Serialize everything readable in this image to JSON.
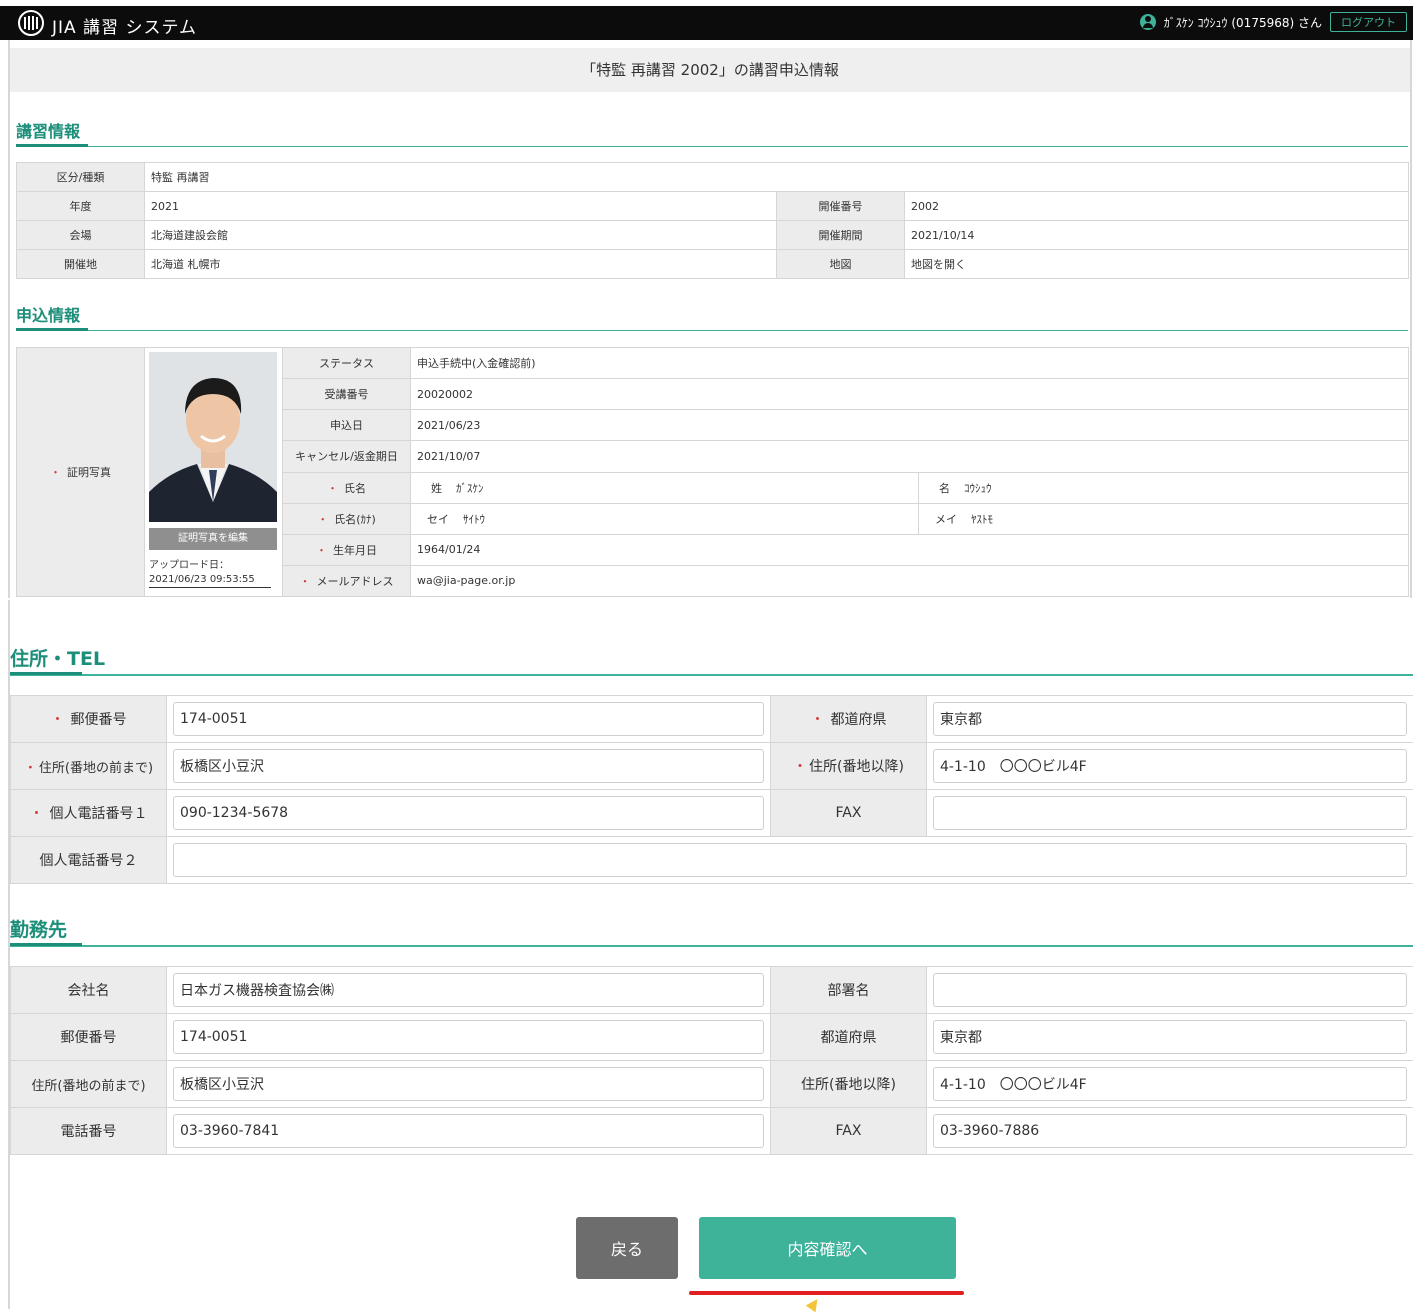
{
  "header": {
    "app_title": "JIA 講習 システム",
    "user_text": "ｶﾞｽｹﾝ ｺｳｼｭｳ (0175968) さん",
    "logout_label": "ログアウト",
    "accent_color": "#3fb29a"
  },
  "page_title": "「特監 再講習 2002」の講習申込情報",
  "course_info": {
    "section_title": "講習情報",
    "rows": {
      "category_label": "区分/種類",
      "category_value": "特監 再講習",
      "year_label": "年度",
      "year_value": "2021",
      "session_no_label": "開催番号",
      "session_no_value": "2002",
      "venue_label": "会場",
      "venue_value": "北海道建設会館",
      "period_label": "開催期間",
      "period_value": "2021/10/14",
      "location_label": "開催地",
      "location_value": "北海道 札幌市",
      "map_label": "地図",
      "map_value": "地図を開く"
    }
  },
  "application_info": {
    "section_title": "申込情報",
    "photo_label": "証明写真",
    "edit_photo_label": "証明写真を編集",
    "upload_label": "アップロード日：",
    "upload_value": "2021/06/23 09:53:55",
    "status_label": "ステータス",
    "status_value": "申込手続中(入金確認前)",
    "student_no_label": "受講番号",
    "student_no_value": "20020002",
    "apply_date_label": "申込日",
    "apply_date_value": "2021/06/23",
    "cancel_date_label": "キャンセル/返金期日",
    "cancel_date_value": "2021/10/07",
    "name_label": "氏名",
    "last_name_label": "姓",
    "last_name_value": "ｶﾞｽｹﾝ",
    "first_name_label": "名",
    "first_name_value": "ｺｳｼｭｳ",
    "kana_label": "氏名(ｶﾅ)",
    "kana_last_label": "セイ",
    "kana_last_value": "ｻｲﾄｳ",
    "kana_first_label": "メイ",
    "kana_first_value": "ﾔｽﾄﾓ",
    "birth_label": "生年月日",
    "birth_value": "1964/01/24",
    "email_label": "メールアドレス",
    "email_value": "wa@jia-page.or.jp"
  },
  "address": {
    "section_title": "住所・TEL",
    "postal_label": "郵便番号",
    "postal_value": "174-0051",
    "pref_label": "都道府県",
    "pref_value": "東京都",
    "addr1_label": "住所(番地の前まで)",
    "addr1_value": "板橋区小豆沢",
    "addr2_label": "住所(番地以降)",
    "addr2_value": "4-1-10　〇〇〇ビル4F",
    "tel1_label": "個人電話番号１",
    "tel1_value": "090-1234-5678",
    "fax_label": "FAX",
    "fax_value": "",
    "tel2_label": "個人電話番号２",
    "tel2_value": ""
  },
  "work": {
    "section_title": "勤務先",
    "company_label": "会社名",
    "company_value": "日本ガス機器検査協会㈱",
    "dept_label": "部署名",
    "dept_value": "",
    "postal_label": "郵便番号",
    "postal_value": "174-0051",
    "pref_label": "都道府県",
    "pref_value": "東京都",
    "addr1_label": "住所(番地の前まで)",
    "addr1_value": "板橋区小豆沢",
    "addr2_label": "住所(番地以降)",
    "addr2_value": "4-1-10　〇〇〇ビル4F",
    "tel_label": "電話番号",
    "tel_value": "03-3960-7841",
    "fax_label": "FAX",
    "fax_value": "03-3960-7886"
  },
  "actions": {
    "back_label": "戻る",
    "confirm_label": "内容確認へ"
  }
}
